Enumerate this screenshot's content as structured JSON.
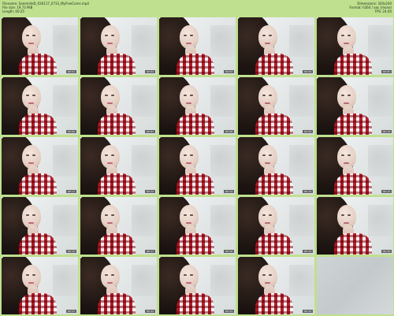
{
  "header": {
    "left": [
      "Filename: Sammi4eD_030117_0733_MyFreeCams.mp4",
      "File size: 19.73 MiB",
      "Length: 00:25"
    ],
    "right": [
      "Dimensions: 320x240",
      "Format: h264 / aac (mono)",
      "FPS: 24.00"
    ]
  },
  "thumbs": [
    {
      "time": "00:01"
    },
    {
      "time": "00:02"
    },
    {
      "time": "00:03"
    },
    {
      "time": "00:04"
    },
    {
      "time": "00:05"
    },
    {
      "time": "00:06"
    },
    {
      "time": "00:07"
    },
    {
      "time": "00:08"
    },
    {
      "time": "00:09"
    },
    {
      "time": "00:10"
    },
    {
      "time": "00:11"
    },
    {
      "time": "00:12"
    },
    {
      "time": "00:13"
    },
    {
      "time": "00:14"
    },
    {
      "time": "00:15"
    },
    {
      "time": "00:16"
    },
    {
      "time": "00:17"
    },
    {
      "time": "00:18"
    },
    {
      "time": "00:19"
    },
    {
      "time": "00:20"
    },
    {
      "time": "00:21"
    },
    {
      "time": "00:22"
    },
    {
      "time": "00:23"
    },
    {
      "time": "00:24"
    },
    {
      "time": ""
    }
  ]
}
